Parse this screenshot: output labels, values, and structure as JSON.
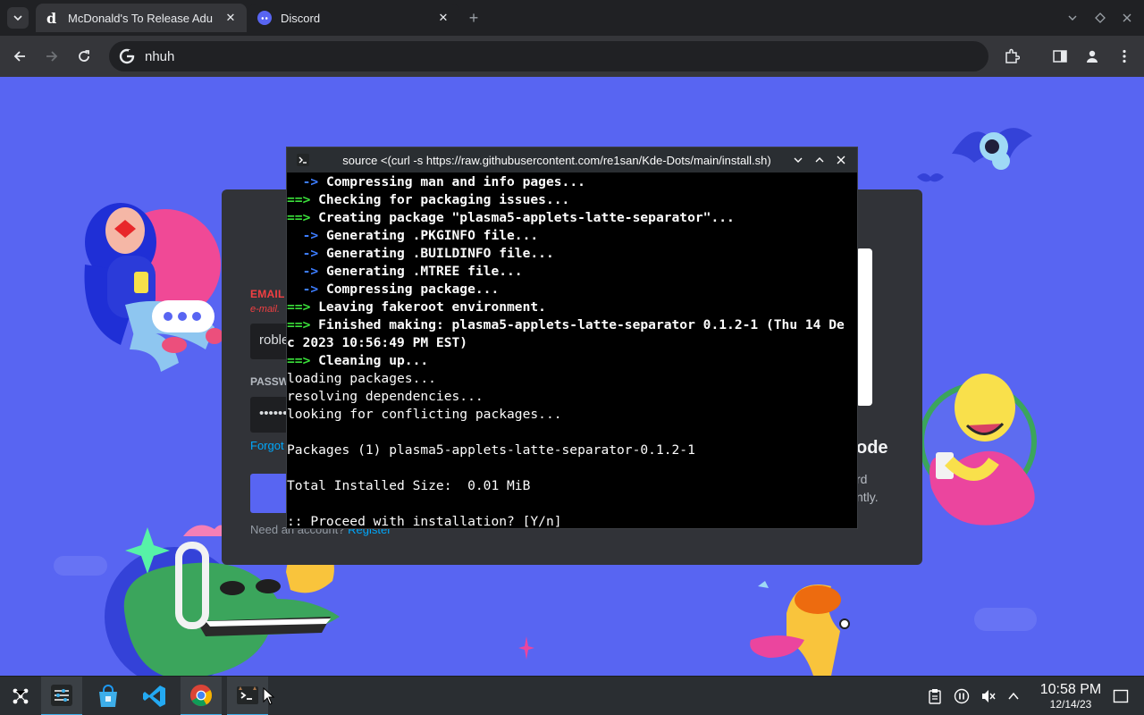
{
  "browser": {
    "tabs": [
      {
        "title": "McDonald's To Release Adu",
        "favicon": "d-letter-icon",
        "active": true
      },
      {
        "title": "Discord",
        "favicon": "discord-icon",
        "active": false
      }
    ],
    "address": "nhuh"
  },
  "discord": {
    "email_label": "EMAIL",
    "email_error": "e-mail.",
    "email_value": "roble",
    "password_label": "PASSW",
    "password_value": "••••••",
    "forgot": "Forgot",
    "need_account": "Need an account?",
    "register": "Register",
    "qr_title": "ode",
    "qr_sub_1": "rd",
    "qr_sub_2": "ntly."
  },
  "terminal": {
    "title": "source <(curl -s https://raw.githubusercontent.com/re1san/Kde-Dots/main/install.sh)",
    "lines": [
      {
        "prefix": "  ->",
        "pcolor": "blue",
        "text": " Compressing man and info pages...",
        "bold": true
      },
      {
        "prefix": "==>",
        "pcolor": "green",
        "text": " Checking for packaging issues...",
        "bold": true
      },
      {
        "prefix": "==>",
        "pcolor": "green",
        "text": " Creating package \"plasma5-applets-latte-separator\"...",
        "bold": true
      },
      {
        "prefix": "  ->",
        "pcolor": "blue",
        "text": " Generating .PKGINFO file...",
        "bold": true
      },
      {
        "prefix": "  ->",
        "pcolor": "blue",
        "text": " Generating .BUILDINFO file...",
        "bold": true
      },
      {
        "prefix": "  ->",
        "pcolor": "blue",
        "text": " Generating .MTREE file...",
        "bold": true
      },
      {
        "prefix": "  ->",
        "pcolor": "blue",
        "text": " Compressing package...",
        "bold": true
      },
      {
        "prefix": "==>",
        "pcolor": "green",
        "text": " Leaving fakeroot environment.",
        "bold": true
      },
      {
        "prefix": "==>",
        "pcolor": "green",
        "text": " Finished making: plasma5-applets-latte-separator 0.1.2-1 (Thu 14 De",
        "bold": true
      },
      {
        "prefix": "",
        "pcolor": "",
        "text": "c 2023 10:56:49 PM EST)",
        "bold": true
      },
      {
        "prefix": "==>",
        "pcolor": "green",
        "text": " Cleaning up...",
        "bold": true
      },
      {
        "prefix": "",
        "pcolor": "",
        "text": "loading packages...",
        "bold": false
      },
      {
        "prefix": "",
        "pcolor": "",
        "text": "resolving dependencies...",
        "bold": false
      },
      {
        "prefix": "",
        "pcolor": "",
        "text": "looking for conflicting packages...",
        "bold": false
      },
      {
        "prefix": "",
        "pcolor": "",
        "text": "",
        "bold": false
      },
      {
        "prefix": "",
        "pcolor": "",
        "text": "Packages (1) plasma5-applets-latte-separator-0.1.2-1",
        "bold": false
      },
      {
        "prefix": "",
        "pcolor": "",
        "text": "",
        "bold": false
      },
      {
        "prefix": "",
        "pcolor": "",
        "text": "Total Installed Size:  0.01 MiB",
        "bold": false
      },
      {
        "prefix": "",
        "pcolor": "",
        "text": "",
        "bold": false
      },
      {
        "prefix": "",
        "pcolor": "",
        "text": ":: Proceed with installation? [Y/n]",
        "bold": false
      }
    ]
  },
  "taskbar": {
    "apps": [
      "app-launcher-icon",
      "settings-icon",
      "discover-store-icon",
      "vscode-icon",
      "chrome-icon",
      "konsole-icon"
    ],
    "time": "10:58 PM",
    "date": "12/14/23"
  },
  "colors": {
    "discord_blurple": "#5865f2",
    "terminal_green": "#3ae03a",
    "terminal_blue": "#3d7dff",
    "accent": "#3daee9"
  }
}
